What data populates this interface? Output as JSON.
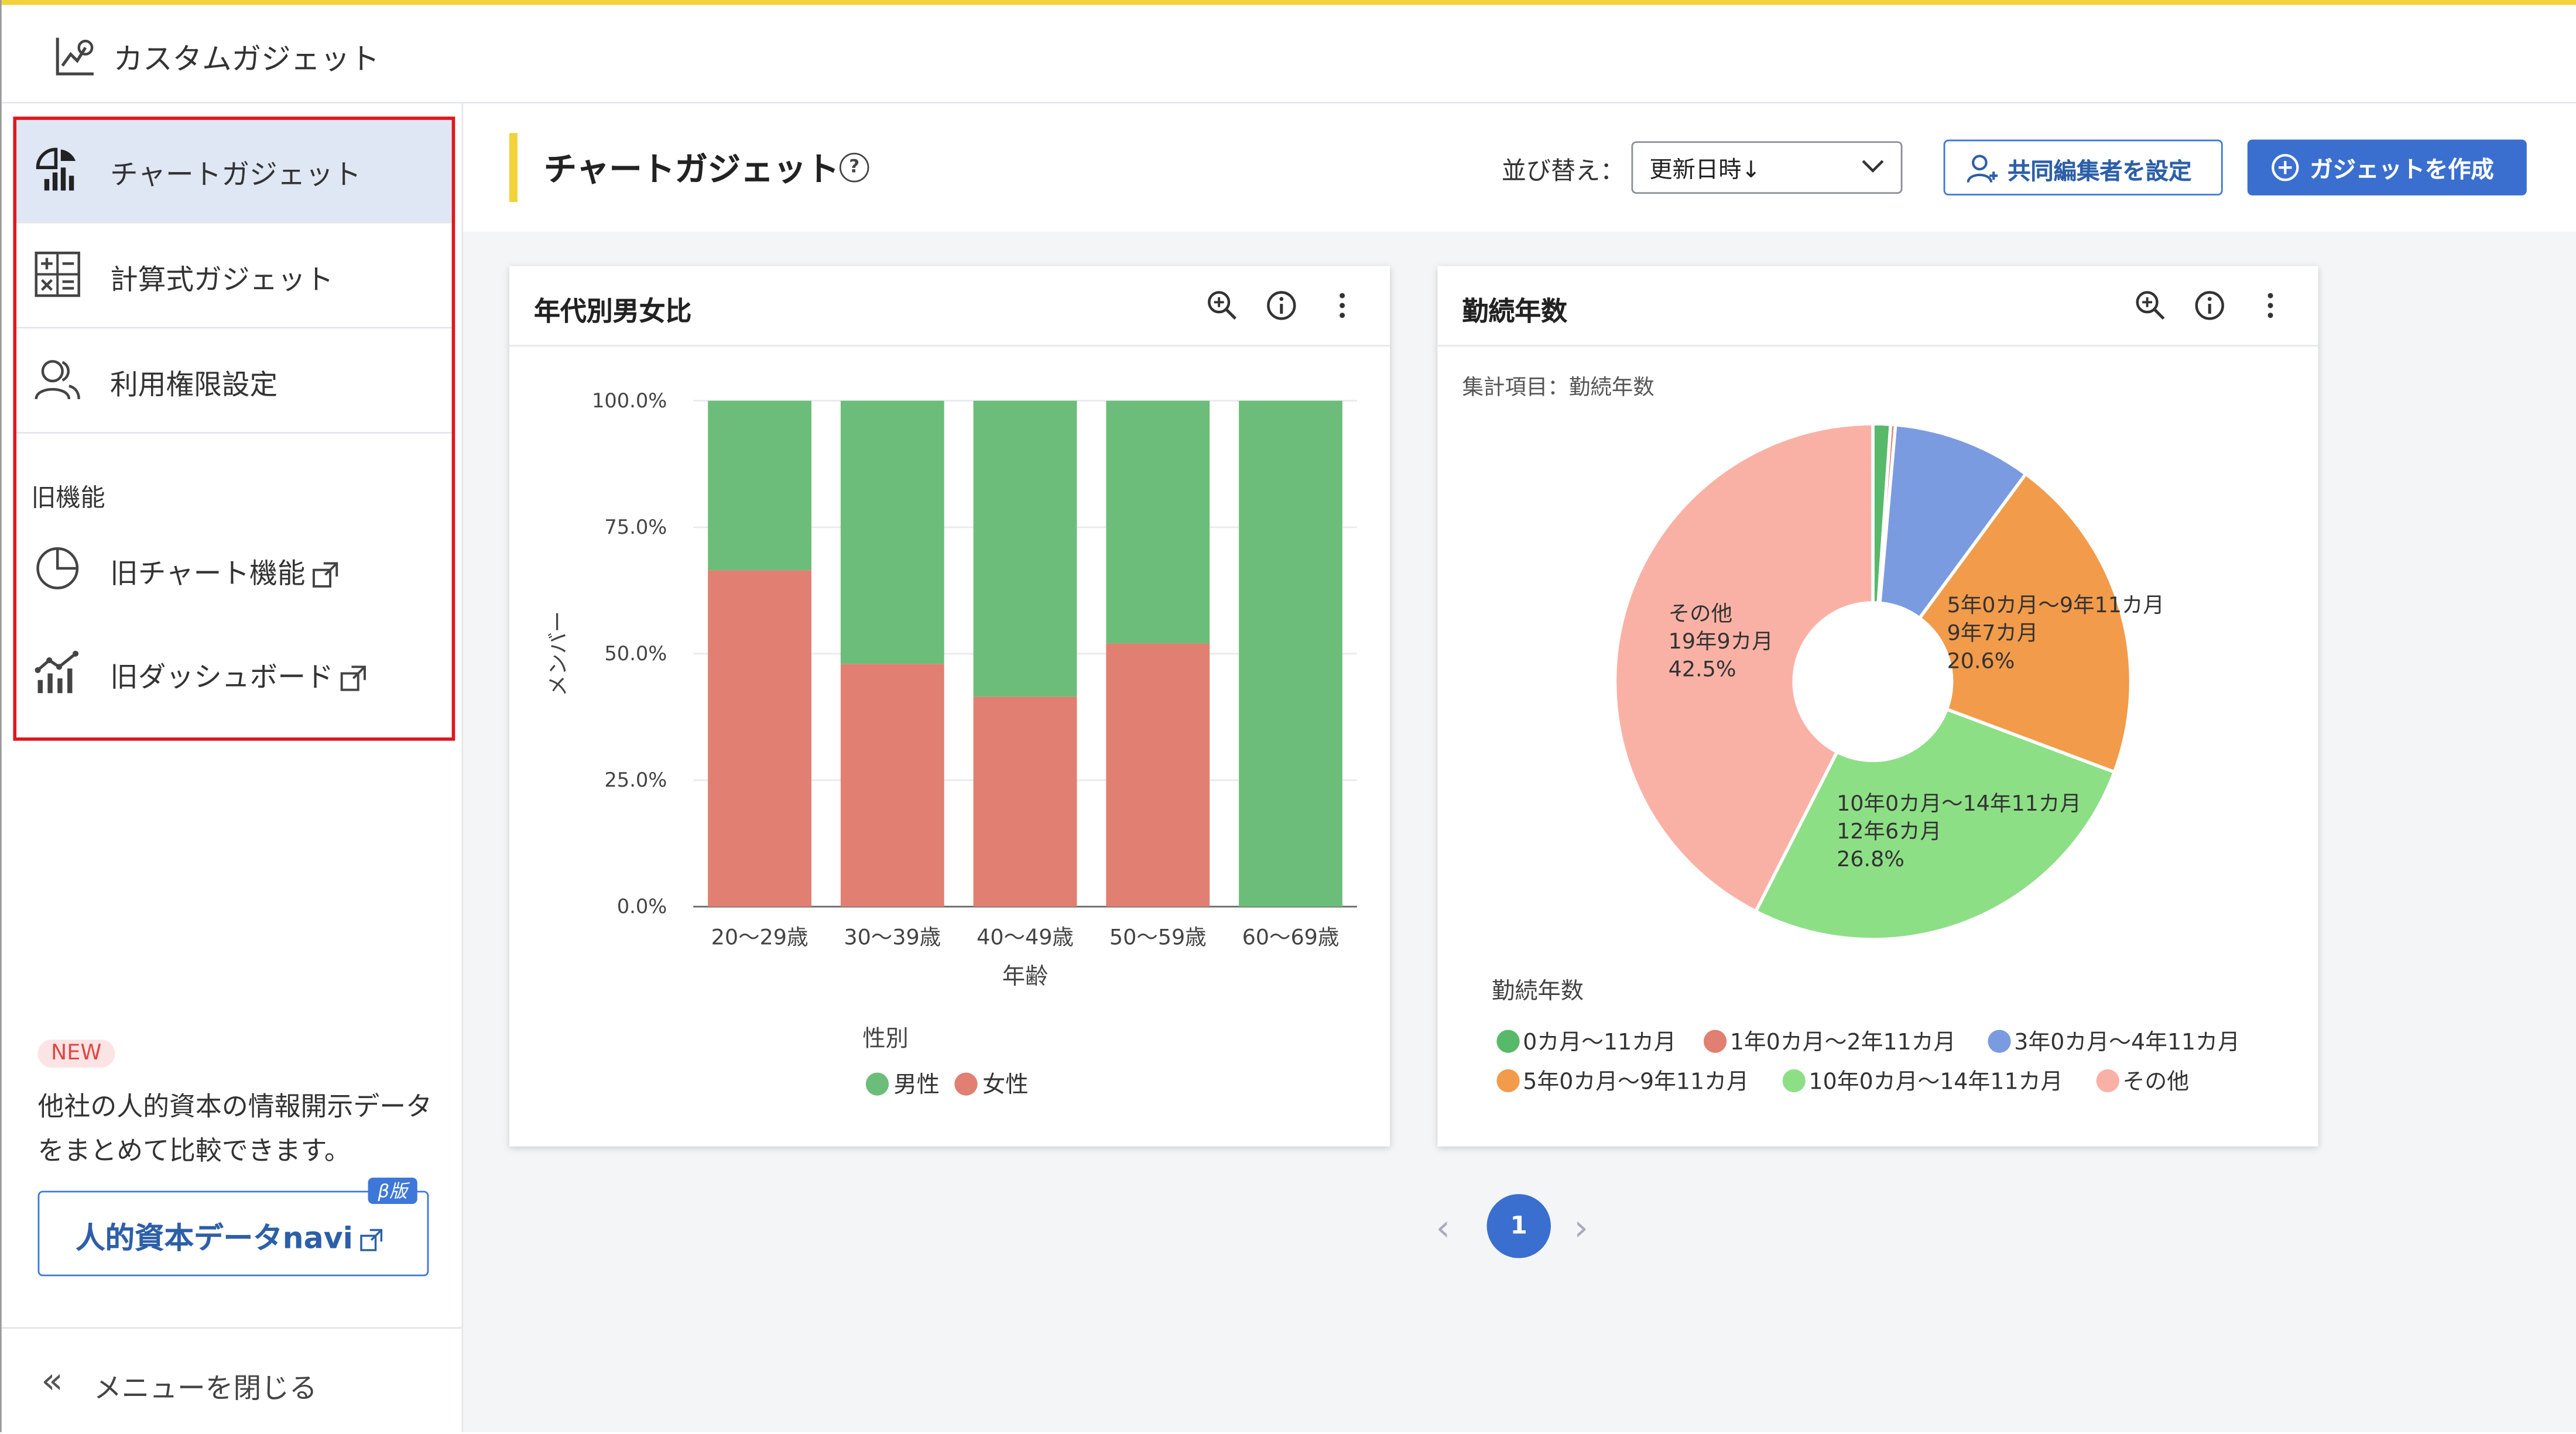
{
  "app": {
    "title": "カスタムガジェット"
  },
  "sidebar": {
    "items": [
      {
        "label": "チャートガジェット",
        "icon": "chart-gadget-icon",
        "active": true
      },
      {
        "label": "計算式ガジェット",
        "icon": "calculator-icon",
        "active": false
      },
      {
        "label": "利用権限設定",
        "icon": "users-icon",
        "active": false
      }
    ],
    "legacy_section_label": "旧機能",
    "legacy_items": [
      {
        "label": "旧チャート機能",
        "icon": "pie-chart-icon"
      },
      {
        "label": "旧ダッシュボード",
        "icon": "dashboard-chart-icon"
      }
    ],
    "promo": {
      "badge": "NEW",
      "text": "他社の人的資本の情報開示データをまとめて比較できます。",
      "button_label": "人的資本データnavi",
      "beta_badge": "β版"
    },
    "close_menu_label": "メニューを閉じる"
  },
  "toolbar": {
    "title": "チャートガジェット",
    "help_symbol": "?",
    "sort_label": "並び替え：",
    "sort_value": "更新日時↓",
    "coeditor_button": "共同編集者を設定",
    "create_button": "ガジェットを作成"
  },
  "cards": [
    {
      "title": "年代別男女比",
      "chart_data": {
        "type": "bar",
        "stacked": true,
        "categories": [
          "20～29歳",
          "30～39歳",
          "40～49歳",
          "50～59歳",
          "60～69歳"
        ],
        "series": [
          {
            "name": "女性",
            "color": "#e07f72",
            "values": [
              66.5,
              48,
              41.5,
              52,
              0
            ]
          },
          {
            "name": "男性",
            "color": "#6dbd7a",
            "values": [
              33.5,
              52,
              58.5,
              48,
              100
            ]
          }
        ],
        "ylim": [
          0,
          100
        ],
        "yticks": [
          "0.0%",
          "25.0%",
          "50.0%",
          "75.0%",
          "100.0%"
        ],
        "xlabel": "年齢",
        "ylabel": "メンバー",
        "legend_title": "性別",
        "legend_order": [
          "男性",
          "女性"
        ],
        "legend_position": "bottom"
      }
    },
    {
      "title": "勤続年数",
      "subtitle": "集計項目：勤続年数",
      "chart_data": {
        "type": "pie",
        "donut": true,
        "slices": [
          {
            "name": "0カ月〜11カ月",
            "value": 1.1,
            "color": "#58b96a"
          },
          {
            "name": "1年0カ月〜2年11カ月",
            "value": 0.3,
            "color": "#e07f72"
          },
          {
            "name": "3年0カ月〜4年11カ月",
            "value": 8.7,
            "color": "#7b9be0"
          },
          {
            "name": "5年0カ月〜9年11カ月",
            "value": 20.6,
            "color": "#f29b4a",
            "label": [
              "5年0カ月〜9年11カ月",
              "9年7カ月",
              "20.6%"
            ]
          },
          {
            "name": "10年0カ月〜14年11カ月",
            "value": 26.8,
            "color": "#8ddf86",
            "label": [
              "10年0カ月〜14年11カ月",
              "12年6カ月",
              "26.8%"
            ]
          },
          {
            "name": "その他",
            "value": 42.5,
            "color": "#fab1a5",
            "label": [
              "その他",
              "19年9カ月",
              "42.5%"
            ]
          }
        ],
        "legend_title": "勤続年数",
        "legend_position": "bottom"
      }
    }
  ],
  "pagination": {
    "prev": "‹",
    "current": "1",
    "next": "›"
  },
  "colors": {
    "accent_yellow": "#f2d23a",
    "primary_blue": "#3a6fcf",
    "highlight_red": "#e0161e"
  }
}
